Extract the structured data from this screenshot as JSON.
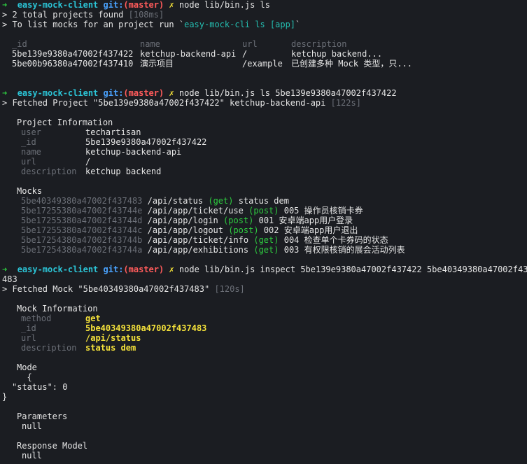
{
  "prompt": {
    "arrow": "➜",
    "dir": "easy-mock-client",
    "git": "git:",
    "branch": "(master)",
    "dirty": "✗"
  },
  "cmd1": "node lib/bin.js ls",
  "ls_summary": "> 2 total projects found ",
  "ls_time": "[108ms]",
  "ls_hint_pre": "> To list mocks for an project run `",
  "ls_hint_cmd": "easy-mock-cli ls [app]",
  "ls_hint_post": "`",
  "table_headers": {
    "id": "_id",
    "name": "name",
    "url": "url",
    "desc": "description"
  },
  "projects": [
    {
      "id": "5be139e9380a47002f437422",
      "name": "ketchup-backend-api",
      "url": "/",
      "desc": "ketchup backend..."
    },
    {
      "id": "5be00b96380a47002f437410",
      "name": "演示项目",
      "url": "/example",
      "desc": "已创建多种 Mock 类型，只..."
    }
  ],
  "cmd2": "node lib/bin.js ls 5be139e9380a47002f437422",
  "fetch_project": "> Fetched Project \"5be139e9380a47002f437422\" ketchup-backend-api ",
  "fetch_project_time": "[122s]",
  "project_info_title": "Project Information",
  "project_info": [
    {
      "k": "user",
      "v": "techartisan"
    },
    {
      "k": "_id",
      "v": "5be139e9380a47002f437422"
    },
    {
      "k": "name",
      "v": "ketchup-backend-api"
    },
    {
      "k": "url",
      "v": "/"
    },
    {
      "k": "description",
      "v": "ketchup backend"
    }
  ],
  "mocks_title": "Mocks",
  "mocks": [
    {
      "id": "5be40349380a47002f437483",
      "url": "/api/status",
      "method": "(get)",
      "desc": "status dem"
    },
    {
      "id": "5be17255380a47002f43744e",
      "url": "/api/app/ticket/use",
      "method": "(post)",
      "desc": "005 操作员核销卡券"
    },
    {
      "id": "5be17255380a47002f43744d",
      "url": "/api/app/login",
      "method": "(post)",
      "desc": "001 安卓端app用户登录"
    },
    {
      "id": "5be17255380a47002f43744c",
      "url": "/api/app/logout",
      "method": "(post)",
      "desc": "002 安卓端app用户退出"
    },
    {
      "id": "5be17254380a47002f43744b",
      "url": "/api/app/ticket/info",
      "method": "(get)",
      "desc": "004 检查单个卡券码的状态"
    },
    {
      "id": "5be17254380a47002f43744a",
      "url": "/api/app/exhibitions",
      "method": "(get)",
      "desc": "003 有权限核销的展会活动列表"
    }
  ],
  "cmd3": "node lib/bin.js inspect 5be139e9380a47002f437422 5be40349380a47002f437",
  "cmd3_wrap": "483",
  "fetch_mock": "> Fetched Mock \"5be40349380a47002f437483\" ",
  "fetch_mock_time": "[120s]",
  "mock_info_title": "Mock Information",
  "mock_info": [
    {
      "k": "method",
      "v": "get"
    },
    {
      "k": "_id",
      "v": "5be40349380a47002f437483"
    },
    {
      "k": "url",
      "v": "/api/status"
    },
    {
      "k": "description",
      "v": "status dem"
    }
  ],
  "mode_title": "Mode",
  "mode_lines": [
    "  {",
    "\"status\": 0",
    "}"
  ],
  "params_title": "Parameters",
  "params_value": "null",
  "response_title": "Response Model",
  "response_value": "null"
}
